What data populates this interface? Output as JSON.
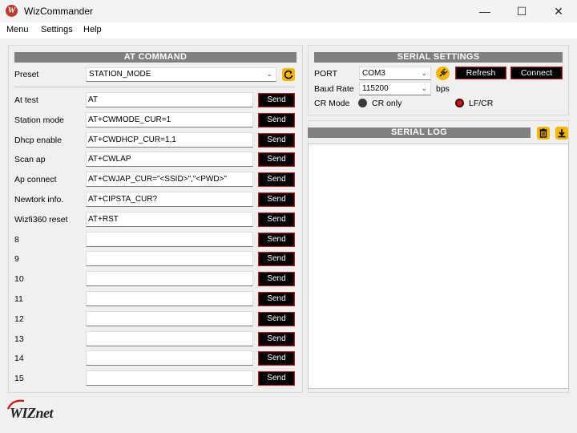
{
  "window": {
    "title": "WizCommander",
    "app_icon_letter": "W",
    "minimize": "—",
    "maximize": "☐",
    "close": "✕"
  },
  "menu": [
    {
      "label": "Menu"
    },
    {
      "label": "Settings"
    },
    {
      "label": "Help"
    }
  ],
  "at_command": {
    "header": "AT COMMAND",
    "preset_label": "Preset",
    "preset_value": "STATION_MODE",
    "send_label": "Send",
    "rows": [
      {
        "label": "At test",
        "value": "AT"
      },
      {
        "label": "Station mode",
        "value": "AT+CWMODE_CUR=1"
      },
      {
        "label": "Dhcp enable",
        "value": "AT+CWDHCP_CUR=1,1"
      },
      {
        "label": "Scan ap",
        "value": "AT+CWLAP"
      },
      {
        "label": "Ap connect",
        "value": "AT+CWJAP_CUR=\"<SSID>\",\"<PWD>\""
      },
      {
        "label": "Newtork info.",
        "value": "AT+CIPSTA_CUR?"
      },
      {
        "label": "Wizfi360 reset",
        "value": "AT+RST"
      },
      {
        "label": "8",
        "value": ""
      },
      {
        "label": "9",
        "value": ""
      },
      {
        "label": "10",
        "value": ""
      },
      {
        "label": "11",
        "value": ""
      },
      {
        "label": "12",
        "value": ""
      },
      {
        "label": "13",
        "value": ""
      },
      {
        "label": "14",
        "value": ""
      },
      {
        "label": "15",
        "value": ""
      }
    ]
  },
  "serial_settings": {
    "header": "SERIAL SETTINGS",
    "port_label": "PORT",
    "port_value": "COM3",
    "refresh_label": "Refresh",
    "connect_label": "Connect",
    "baud_label": "Baud Rate",
    "baud_value": "115200",
    "baud_unit": "bps",
    "cr_mode_label": "CR Mode",
    "cr_only_label": "CR only",
    "lf_cr_label": "LF/CR",
    "selected_mode": "LF/CR"
  },
  "serial_log": {
    "header": "SERIAL LOG"
  },
  "logo": {
    "text": "WIZnet"
  },
  "colors": {
    "accent": "#e01010",
    "icon_yellow": "#f5b800",
    "header_gray": "#808080"
  }
}
